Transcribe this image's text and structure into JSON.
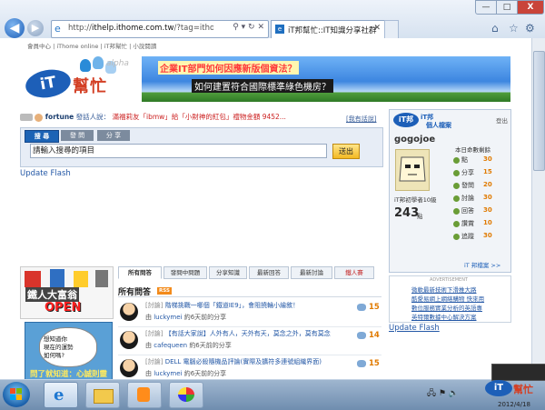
{
  "browser": {
    "url_prefix": "http://",
    "url_host": "ithelp.ithome.com.tw",
    "url_rest": "/?tag=ithon",
    "tab_title": "iT邦幫忙::IT知識分享社群",
    "window_buttons": {
      "minimize": "—",
      "maximize": "□",
      "close": "X"
    },
    "toolbar_icons": [
      "home-icon",
      "favorites-star-icon",
      "tools-gear-icon"
    ]
  },
  "header": {
    "top_links": "會員中心 | iThome online | iT邦幫忙 | 小說閱讀",
    "logo_it": "iT",
    "logo_name": "幫忙",
    "logo_alpha": "alpha",
    "banner_line1": "企業IT部門如何因應新版個資法？",
    "banner_line2": "如何建置符合國際標準綠色機房？"
  },
  "ticker": {
    "user": "fortune",
    "mid": "發話人說：",
    "text": "滿福莉友「ibmw」給「小財神的紅包」禮物金額 9452...",
    "suggest_link": "[我有話說]"
  },
  "search": {
    "tabs": [
      "搜 尋",
      "發 問",
      "分 享"
    ],
    "placeholder": "請輸入搜尋的項目",
    "button": "送出"
  },
  "flash_text_1": "Update Flash",
  "flash_text_2": "Update Flash",
  "profile": {
    "title": "iT邦",
    "subtitle": "個人檔案",
    "logout": "登出",
    "username": "gogojoe",
    "level": "iT邦初學者10級",
    "points": "243",
    "points_unit": "點",
    "stats_header": "本日命數剩餘",
    "stats": [
      {
        "label": "點",
        "value": "30"
      },
      {
        "label": "分享",
        "value": "15"
      },
      {
        "label": "發問",
        "value": "20"
      },
      {
        "label": "討論",
        "value": "30"
      },
      {
        "label": "回答",
        "value": "30"
      },
      {
        "label": "讚賞",
        "value": "10"
      },
      {
        "label": "追蹤",
        "value": "30"
      }
    ],
    "files_link": "iT 邦檔案 >>"
  },
  "ad_sidebar": {
    "label": "ADVERTISEMENT",
    "lines": [
      "微軟最新技術下滑推大路",
      "酷愛易網上網絡購物 快來用",
      "數位服務實業分析的英語專",
      "英特爾數據中心解決方案"
    ]
  },
  "left_ads": {
    "robot_title": "鐵人大富翁",
    "robot_open": "OPEN",
    "bubble_lines": [
      "想知道你",
      "現在的運勢",
      "如何嗎?"
    ],
    "bottom_text": "問了就知道：心誠則靈"
  },
  "qa": {
    "tabs": [
      "所有問答",
      "發問中問題",
      "分享知識",
      "最新回答",
      "最新討論",
      "鐵人賽"
    ],
    "title": "所有問答",
    "rss": "RSS",
    "rows": [
      {
        "tag": "[討論]",
        "title": "階梯挑戰一哪個「鐵道IE9」，會阻撓輪小繪敘！",
        "by_prefix": "由",
        "user": "luckymei",
        "ago": "約6天前的分享",
        "count": "15"
      },
      {
        "tag": "[討論]",
        "title": "【有話大家說】人外有人，天外有天，莫念之外，莫有莫念",
        "by_prefix": "由",
        "user": "cafequeen",
        "ago": "約6天前的分享",
        "count": "14"
      },
      {
        "tag": "[討論]",
        "title": "DELL 電腦必殺隨機品評論(實際及擴符多連號組織界面)",
        "by_prefix": "由",
        "user": "luckymei",
        "ago": "約6天前的分享",
        "count": "15"
      }
    ]
  },
  "taskbar": {
    "apps": [
      "ie-icon",
      "folder-icon",
      "media-player-icon",
      "paint-icon"
    ],
    "clock": "2012/4/18"
  },
  "colors": {
    "accent_blue": "#1d5fb8",
    "brand_red": "#d33f24",
    "count_orange": "#e07a00"
  }
}
